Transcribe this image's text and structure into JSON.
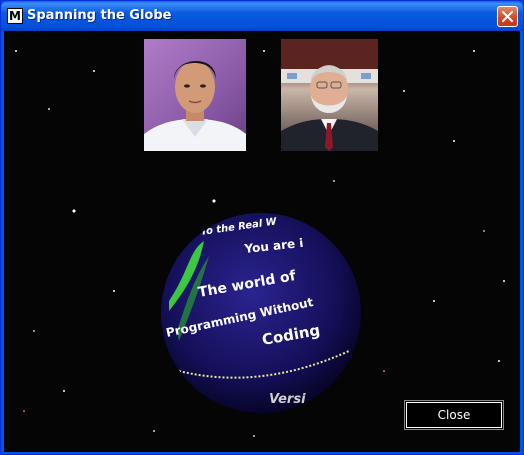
{
  "window": {
    "title": "Spanning the Globe",
    "app_icon_letter": "M",
    "close_icon": "close-x-icon"
  },
  "photos": [
    {
      "name": "young-man-portrait"
    },
    {
      "name": "older-man-portrait"
    }
  ],
  "globe": {
    "lines": [
      "To the Real W",
      "You are i",
      "The world of",
      "Programming Without",
      "Coding",
      "Versi"
    ],
    "colors": {
      "sphere": "#1a1466",
      "text": "#ffffff",
      "accent": "#3fdc3f",
      "rim": "#e6e6a0"
    }
  },
  "buttons": {
    "close_label": "Close"
  }
}
